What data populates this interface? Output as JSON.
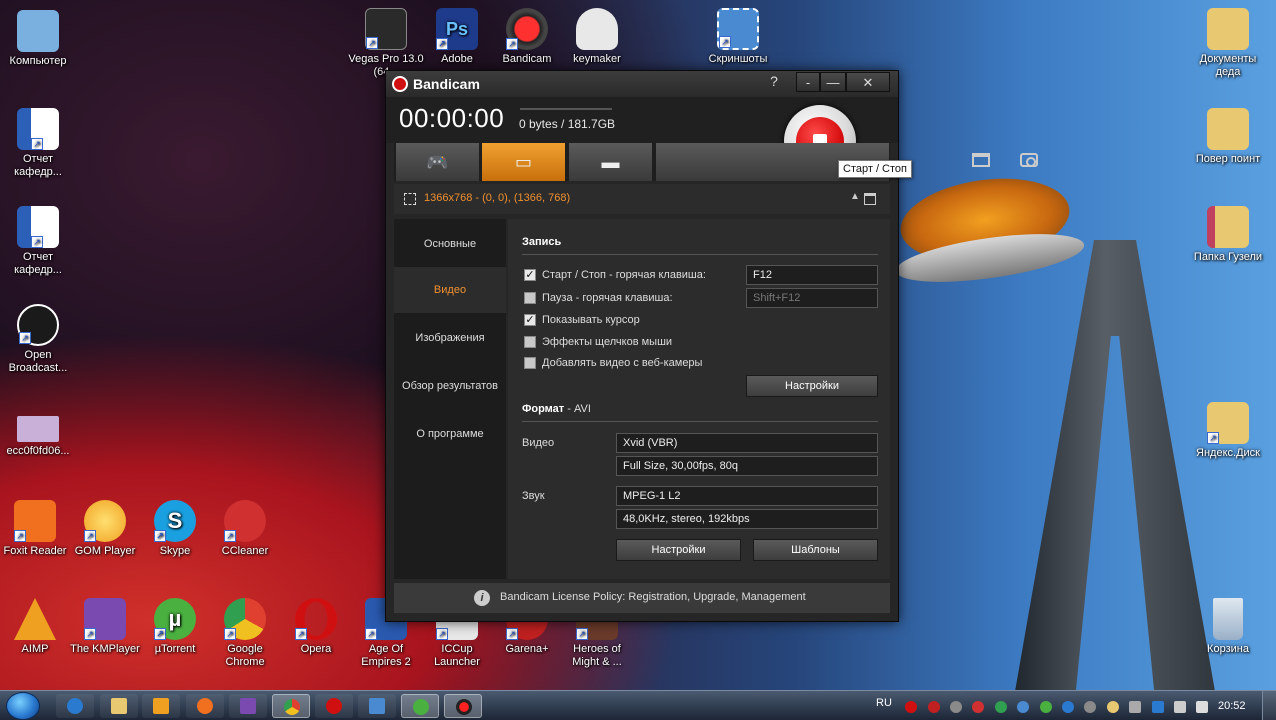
{
  "desktop": {
    "icons": [
      {
        "id": "computer",
        "label": "Компьютер",
        "color": "#7ab0e0"
      },
      {
        "id": "vegas",
        "label": "Vegas Pro 13.0 (64...",
        "color": "#2a2a2a"
      },
      {
        "id": "adobe",
        "label": "Adobe",
        "color": "#1e3a8a"
      },
      {
        "id": "bandicam",
        "label": "Bandicam",
        "color": "#d01010"
      },
      {
        "id": "keymaker",
        "label": "keymaker",
        "color": "#e8e8e8"
      },
      {
        "id": "screenshots",
        "label": "Скриншоты",
        "color": "#4a8ad0"
      },
      {
        "id": "documents",
        "label": "Документы деда",
        "color": "#e8c870"
      },
      {
        "id": "report1",
        "label": "Отчет кафедр...",
        "color": "#2b5fb8"
      },
      {
        "id": "pover",
        "label": "Повер поинт",
        "color": "#e8c870"
      },
      {
        "id": "report2",
        "label": "Отчет кафедр...",
        "color": "#2b5fb8"
      },
      {
        "id": "papka",
        "label": "Папка Гузели",
        "color": "#e8c870"
      },
      {
        "id": "obs",
        "label": "Open Broadcast...",
        "color": "#1a1a1a"
      },
      {
        "id": "ecc",
        "label": "ecc0f0fd06...",
        "color": "#c8b0d8"
      },
      {
        "id": "yandex",
        "label": "Яндекс.Диск",
        "color": "#e8c870"
      },
      {
        "id": "foxit",
        "label": "Foxit Reader",
        "color": "#f07020"
      },
      {
        "id": "gom",
        "label": "GOM Player",
        "color": "#f0a020"
      },
      {
        "id": "skype",
        "label": "Skype",
        "color": "#1aa0e0"
      },
      {
        "id": "ccleaner",
        "label": "CCleaner",
        "color": "#d03030"
      },
      {
        "id": "aimp",
        "label": "AIMP",
        "color": "#f0a020"
      },
      {
        "id": "kmplayer",
        "label": "The KMPlayer",
        "color": "#7a4ab0"
      },
      {
        "id": "utorrent",
        "label": "µTorrent",
        "color": "#4ab040"
      },
      {
        "id": "chrome",
        "label": "Google Chrome",
        "color": "#e04030"
      },
      {
        "id": "opera",
        "label": "Opera",
        "color": "#d01010"
      },
      {
        "id": "aoe",
        "label": "Age Of Empires 2",
        "color": "#2a5ab0"
      },
      {
        "id": "iccup",
        "label": "ICCup Launcher",
        "color": "#e8e8e8"
      },
      {
        "id": "garena",
        "label": "Garena+",
        "color": "#c02020"
      },
      {
        "id": "heroes",
        "label": "Heroes of Might & ...",
        "color": "#6a3a2a"
      },
      {
        "id": "recycle",
        "label": "Корзина",
        "color": "#b0c8e0"
      }
    ]
  },
  "window": {
    "title": "Bandicam",
    "help": "?",
    "minimize": "-",
    "maximize": "—",
    "close": "✕",
    "timer": "00:00:00",
    "storage": "0 bytes / 181.7GB",
    "tooltip": "Старт / Стоп",
    "region": "1366x768 - (0, 0), (1366, 768)",
    "sidebar": [
      "Основные",
      "Видео",
      "Изображения",
      "Обзор результатов",
      "О программе"
    ],
    "record_section": {
      "title": "Запись",
      "options": [
        {
          "label": "Старт / Стоп - горячая клавиша:",
          "checked": true,
          "hotkey": "F12"
        },
        {
          "label": "Пауза - горячая клавиша:",
          "checked": false,
          "hotkey": "Shift+F12"
        },
        {
          "label": "Показывать курсор",
          "checked": true
        },
        {
          "label": "Эффекты щелчков мыши",
          "checked": false
        },
        {
          "label": "Добавлять видео с веб-камеры",
          "checked": false
        }
      ],
      "settings_button": "Настройки"
    },
    "format_section": {
      "title": "Формат",
      "format_suffix": "- AVI",
      "video_label": "Видео",
      "video_codec": "Xvid (VBR)",
      "video_params": "Full Size, 30,00fps, 80q",
      "audio_label": "Звук",
      "audio_codec": "MPEG-1 L2",
      "audio_params": "48,0KHz, stereo, 192kbps",
      "settings_button": "Настройки",
      "templates_button": "Шаблоны"
    },
    "license": "Bandicam License Policy: Registration, Upgrade, Management"
  },
  "taskbar": {
    "lang": "RU",
    "clock": "20:52"
  }
}
